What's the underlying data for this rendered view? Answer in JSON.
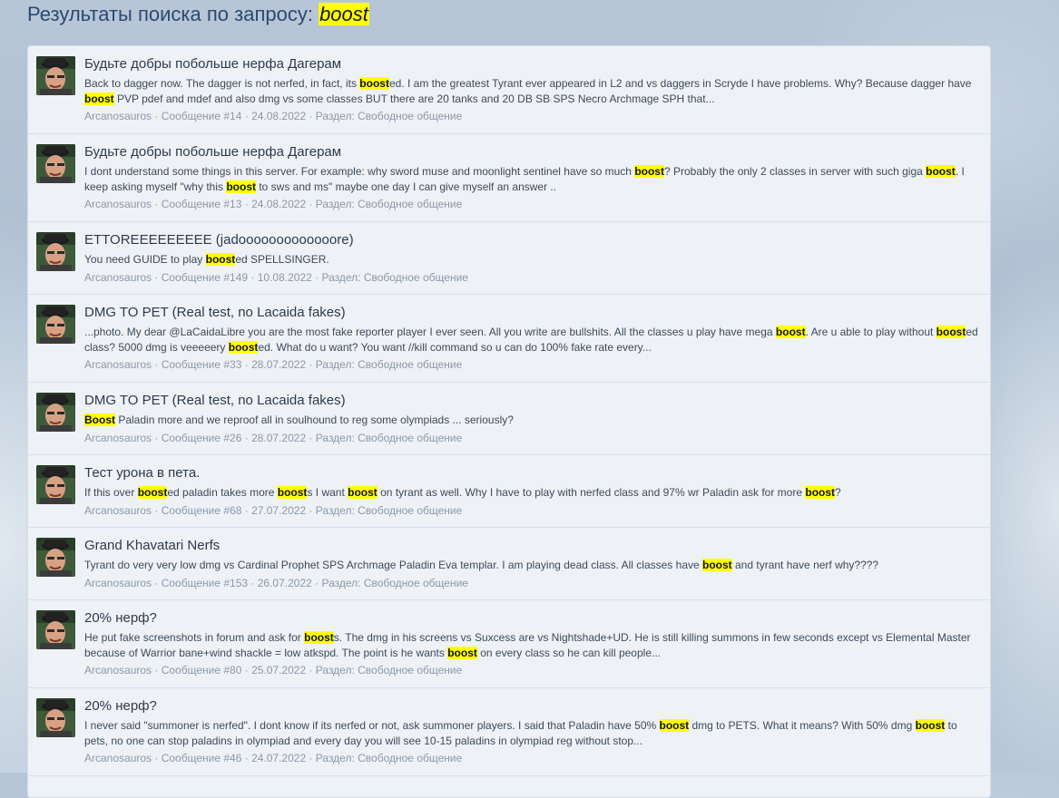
{
  "search": {
    "title_prefix": "Результаты поиска по запросу: ",
    "query": "boost"
  },
  "results": [
    {
      "title": "Будьте добры побольше нерфа Дагерам",
      "snippet": [
        {
          "t": "Back to dagger now. The dagger is not nerfed, in fact, its "
        },
        {
          "t": "boost",
          "hl": true
        },
        {
          "t": "ed. I am the greatest Tyrant ever appeared in L2 and vs daggers in Scryde I have problems. Why? Because dagger have "
        },
        {
          "t": "boost",
          "hl": true
        },
        {
          "t": " PVP pdef and mdef and also dmg vs some classes BUT there are 20 tanks and 20 DB SB SPS Necro Archmage SPH that..."
        }
      ],
      "author": "Arcanosauros",
      "post": "Сообщение #14",
      "date": "24.08.2022",
      "section_label": "Раздел: ",
      "section": "Свободное общение"
    },
    {
      "title": "Будьте добры побольше нерфа Дагерам",
      "snippet": [
        {
          "t": "I dont understand some things in this server. For example: why sword muse and moonlight sentinel have so much "
        },
        {
          "t": "boost",
          "hl": true
        },
        {
          "t": "? Probably the only 2 classes in server with such giga "
        },
        {
          "t": "boost",
          "hl": true
        },
        {
          "t": ". I keep asking myself \"why this "
        },
        {
          "t": "boost",
          "hl": true
        },
        {
          "t": " to sws and ms\" maybe one day I can give myself an answer .."
        }
      ],
      "author": "Arcanosauros",
      "post": "Сообщение #13",
      "date": "24.08.2022",
      "section_label": "Раздел: ",
      "section": "Свободное общение"
    },
    {
      "title": "ETTOREEEEEEEEE (jadooooooooooooore)",
      "snippet": [
        {
          "t": "You need GUIDE to play "
        },
        {
          "t": "boost",
          "hl": true
        },
        {
          "t": "ed SPELLSINGER."
        }
      ],
      "author": "Arcanosauros",
      "post": "Сообщение #149",
      "date": "10.08.2022",
      "section_label": "Раздел: ",
      "section": "Свободное общение"
    },
    {
      "title": "DMG TO PET (Real test, no Lacaida fakes)",
      "snippet": [
        {
          "t": "...photo. My dear @LaCaidaLibre you are the most fake reporter player I ever seen. All you write are bullshits. All the classes u play have mega "
        },
        {
          "t": "boost",
          "hl": true
        },
        {
          "t": ". Are u able to play without "
        },
        {
          "t": "boost",
          "hl": true
        },
        {
          "t": "ed class? 5000 dmg is veeeeery "
        },
        {
          "t": "boost",
          "hl": true
        },
        {
          "t": "ed. What do u want? You want //kill command so u can do 100% fake rate every..."
        }
      ],
      "author": "Arcanosauros",
      "post": "Сообщение #33",
      "date": "28.07.2022",
      "section_label": "Раздел: ",
      "section": "Свободное общение"
    },
    {
      "title": "DMG TO PET (Real test, no Lacaida fakes)",
      "snippet": [
        {
          "t": "Boost",
          "hl": true
        },
        {
          "t": " Paladin more and we reproof all in soulhound to reg some olympiads ... seriously?"
        }
      ],
      "author": "Arcanosauros",
      "post": "Сообщение #26",
      "date": "28.07.2022",
      "section_label": "Раздел: ",
      "section": "Свободное общение"
    },
    {
      "title": "Тест урона в пета.",
      "snippet": [
        {
          "t": "If this over "
        },
        {
          "t": "boost",
          "hl": true
        },
        {
          "t": "ed paladin takes more "
        },
        {
          "t": "boost",
          "hl": true
        },
        {
          "t": "s I want "
        },
        {
          "t": "boost",
          "hl": true
        },
        {
          "t": " on tyrant as well. Why I have to play with nerfed class and 97% wr Paladin ask for more "
        },
        {
          "t": "boost",
          "hl": true
        },
        {
          "t": "?"
        }
      ],
      "author": "Arcanosauros",
      "post": "Сообщение #68",
      "date": "27.07.2022",
      "section_label": "Раздел: ",
      "section": "Свободное общение"
    },
    {
      "title": "Grand Khavatari Nerfs",
      "snippet": [
        {
          "t": "Tyrant do very very low dmg vs Cardinal Prophet SPS Archmage Paladin Eva templar. I am playing dead class. All classes have "
        },
        {
          "t": "boost",
          "hl": true
        },
        {
          "t": " and tyrant have nerf why????"
        }
      ],
      "author": "Arcanosauros",
      "post": "Сообщение #153",
      "date": "26.07.2022",
      "section_label": "Раздел: ",
      "section": "Свободное общение"
    },
    {
      "title": "20% нерф?",
      "snippet": [
        {
          "t": "He put fake screenshots in forum and ask for "
        },
        {
          "t": "boost",
          "hl": true
        },
        {
          "t": "s. The dmg in his screens vs Suxcess are vs Nightshade+UD. He is still killing summons in few seconds except vs Elemental Master because of Warrior bane+wind shackle = low atkspd. The point is he wants "
        },
        {
          "t": "boost",
          "hl": true
        },
        {
          "t": " on every class so he can kill people..."
        }
      ],
      "author": "Arcanosauros",
      "post": "Сообщение #80",
      "date": "25.07.2022",
      "section_label": "Раздел: ",
      "section": "Свободное общение"
    },
    {
      "title": "20% нерф?",
      "snippet": [
        {
          "t": "I never said \"summoner is nerfed\". I dont know if its nerfed or not, ask summoner players. I said that Paladin have 50% "
        },
        {
          "t": "boost",
          "hl": true
        },
        {
          "t": " dmg to PETS. What it means? With 50% dmg "
        },
        {
          "t": "boost",
          "hl": true
        },
        {
          "t": " to pets, no one can stop paladins in olympiad and every day you will see 10-15 paladins in olympiad reg without stop..."
        }
      ],
      "author": "Arcanosauros",
      "post": "Сообщение #46",
      "date": "24.07.2022",
      "section_label": "Раздел: ",
      "section": "Свободное общение"
    }
  ]
}
